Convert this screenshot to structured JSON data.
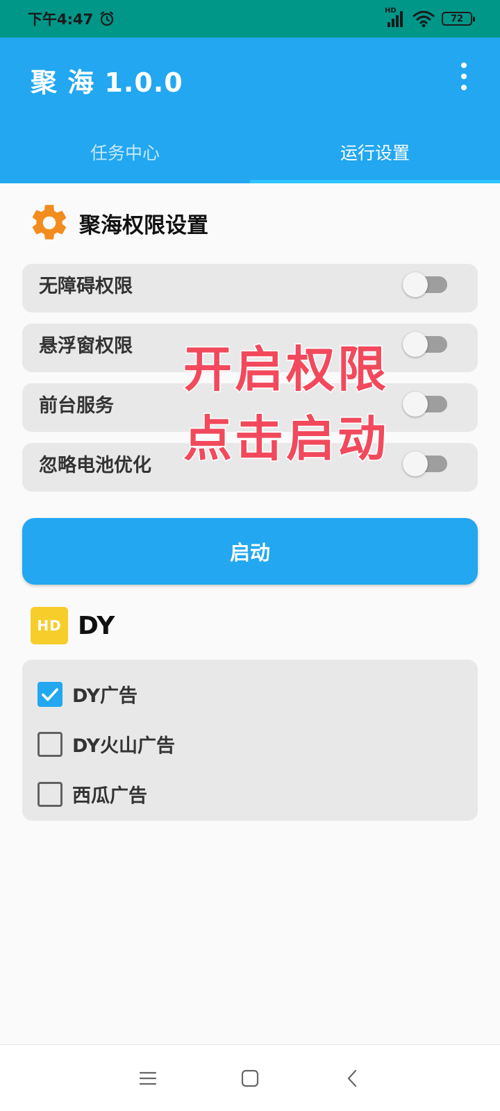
{
  "status_bar": {
    "time": "下午4:47",
    "network_badge": "HD",
    "battery": "72"
  },
  "app_bar": {
    "title": "聚 海 1.0.0",
    "tabs": [
      {
        "label": "任务中心",
        "active": false
      },
      {
        "label": "运行设置",
        "active": true
      }
    ]
  },
  "permissions": {
    "title": "聚海权限设置",
    "items": [
      {
        "label": "无障碍权限",
        "enabled": false
      },
      {
        "label": "悬浮窗权限",
        "enabled": false
      },
      {
        "label": "前台服务",
        "enabled": false
      },
      {
        "label": "忽略电池优化",
        "enabled": false
      }
    ]
  },
  "overlay": {
    "line1": "开启权限",
    "line2": "点击启动"
  },
  "start_button": {
    "label": "启动"
  },
  "dy_section": {
    "badge": "HD",
    "title": "DY",
    "options": [
      {
        "label": "DY广告",
        "checked": true
      },
      {
        "label": "DY火山广告",
        "checked": false
      },
      {
        "label": "西瓜广告",
        "checked": false
      }
    ]
  },
  "colors": {
    "primary": "#22a7f0",
    "status_bar": "#009688",
    "gear": "#f28c1e",
    "badge": "#f6cd2a",
    "overlay_text": "#f2495c"
  }
}
